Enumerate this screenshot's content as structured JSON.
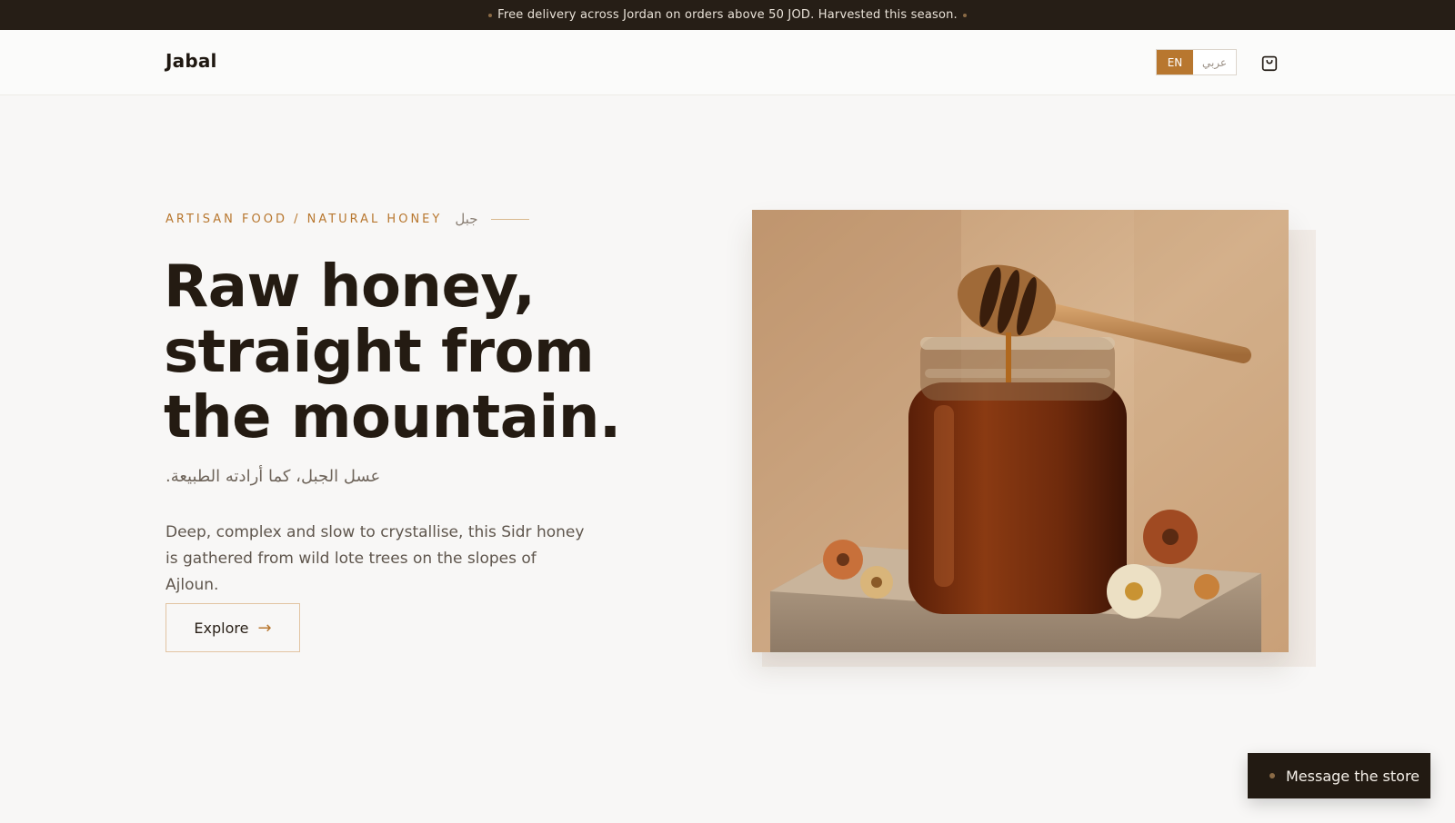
{
  "announcement": {
    "text": "Free delivery across Jordan on orders above 50 JOD. Harvested this season."
  },
  "header": {
    "logo": "Jabal",
    "lang_en": "EN",
    "lang_ar": "عربي",
    "cart_icon": "shopping-bag-icon"
  },
  "hero": {
    "eyebrow": "ARTISAN FOOD / NATURAL HONEY",
    "eyebrow_ar": "جبل",
    "headline": [
      "Raw honey,",
      "straight from",
      "the mountain."
    ],
    "subtitle_ar": "عسل الجبل، كما أرادته الطبيعة.",
    "body": "Deep, complex and slow to crystallise, this Sidr honey is gathered from wild lote trees on the slopes of Ajloun.",
    "cta_label": "Explore",
    "cta_arrow": "→",
    "image_alt": "honey-jar-with-dipper-photo"
  },
  "chat": {
    "label": "Message the store"
  },
  "colors": {
    "accent": "#b8772f",
    "dark": "#261e16",
    "background": "#f8f7f6"
  }
}
